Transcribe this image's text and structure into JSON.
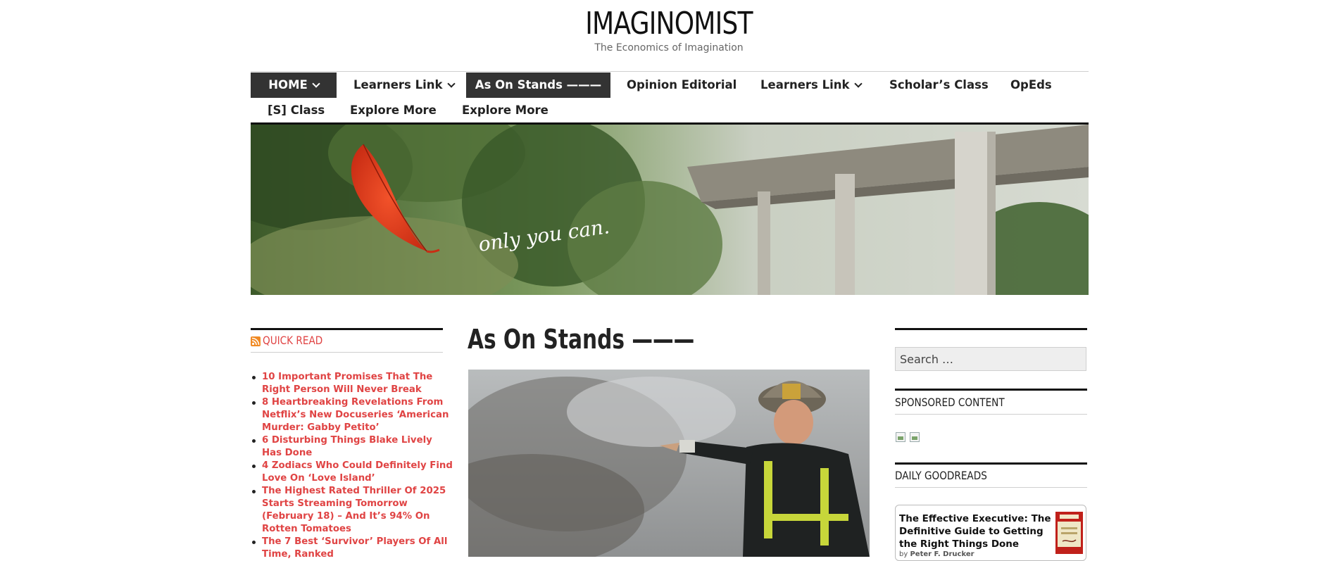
{
  "site": {
    "title": "IMAGINOMIST",
    "tagline": "The Economics of Imagination"
  },
  "nav": {
    "items": [
      {
        "label": "HOME",
        "has_dropdown": true,
        "active": true
      },
      {
        "label": "Learners Link",
        "has_dropdown": true,
        "active": false
      },
      {
        "label": "As On Stands ———",
        "has_dropdown": false,
        "active": true
      },
      {
        "label": "Opinion Editorial",
        "has_dropdown": false,
        "active": false
      },
      {
        "label": "Learners Link",
        "has_dropdown": true,
        "active": false
      },
      {
        "label": "Scholar’s Class",
        "has_dropdown": false,
        "active": false
      },
      {
        "label": "OpEds",
        "has_dropdown": false,
        "active": false
      },
      {
        "label": "[S] Class",
        "has_dropdown": false,
        "active": false
      },
      {
        "label": "Explore More",
        "has_dropdown": false,
        "active": false
      },
      {
        "label": "Explore More",
        "has_dropdown": false,
        "active": false
      }
    ]
  },
  "banner": {
    "caption": "only you can."
  },
  "left_sidebar": {
    "quick_read_title": "QUICK READ",
    "items": [
      "10 Important Promises That The Right Person Will Never Break",
      "8 Heartbreaking Revelations From Netflix’s New Docuseries ‘American Murder: Gabby Petito’",
      "6 Disturbing Things Blake Lively Has Done",
      "4 Zodiacs Who Could Definitely Find Love On ‘Love Island’",
      "The Highest Rated Thriller Of 2025 Starts Streaming Tomorrow (February 18) – And It’s 94% On Rotten Tomatoes",
      "The 7 Best ‘Survivor’ Players Of All Time, Ranked"
    ]
  },
  "main": {
    "title": "As On Stands ———"
  },
  "right_sidebar": {
    "search_placeholder": "Search …",
    "sponsored_title": "SPONSORED CONTENT",
    "goodreads_title": "DAILY GOODREADS",
    "book": {
      "title": "The Effective Executive: The Definitive Guide to Getting the Right Things Done",
      "author_prefix": "by",
      "author": "Peter F. Drucker"
    }
  },
  "colors": {
    "accent_red": "#e04444",
    "nav_active_bg": "#333333"
  }
}
